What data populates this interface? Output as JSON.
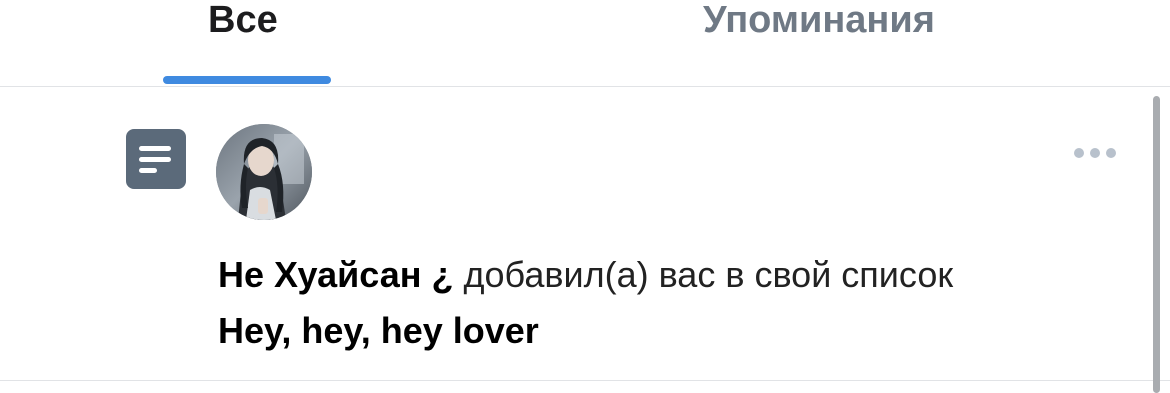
{
  "tabs": [
    {
      "label": "Все",
      "active": true
    },
    {
      "label": "Упоминания",
      "active": false
    }
  ],
  "notification": {
    "type_icon": "text-lines-icon",
    "avatar": "user-avatar",
    "author": "Не Хуайсан ¿",
    "action": "добавил(а) вас в свой список",
    "list_name": "Hey, hey, hey lover",
    "more_icon": "more-horizontal-icon"
  },
  "colors": {
    "accent": "#3f8ae0",
    "tab_inactive": "#6f7985",
    "icon_bg": "#5b6a7a",
    "divider": "#e1e3e6"
  }
}
